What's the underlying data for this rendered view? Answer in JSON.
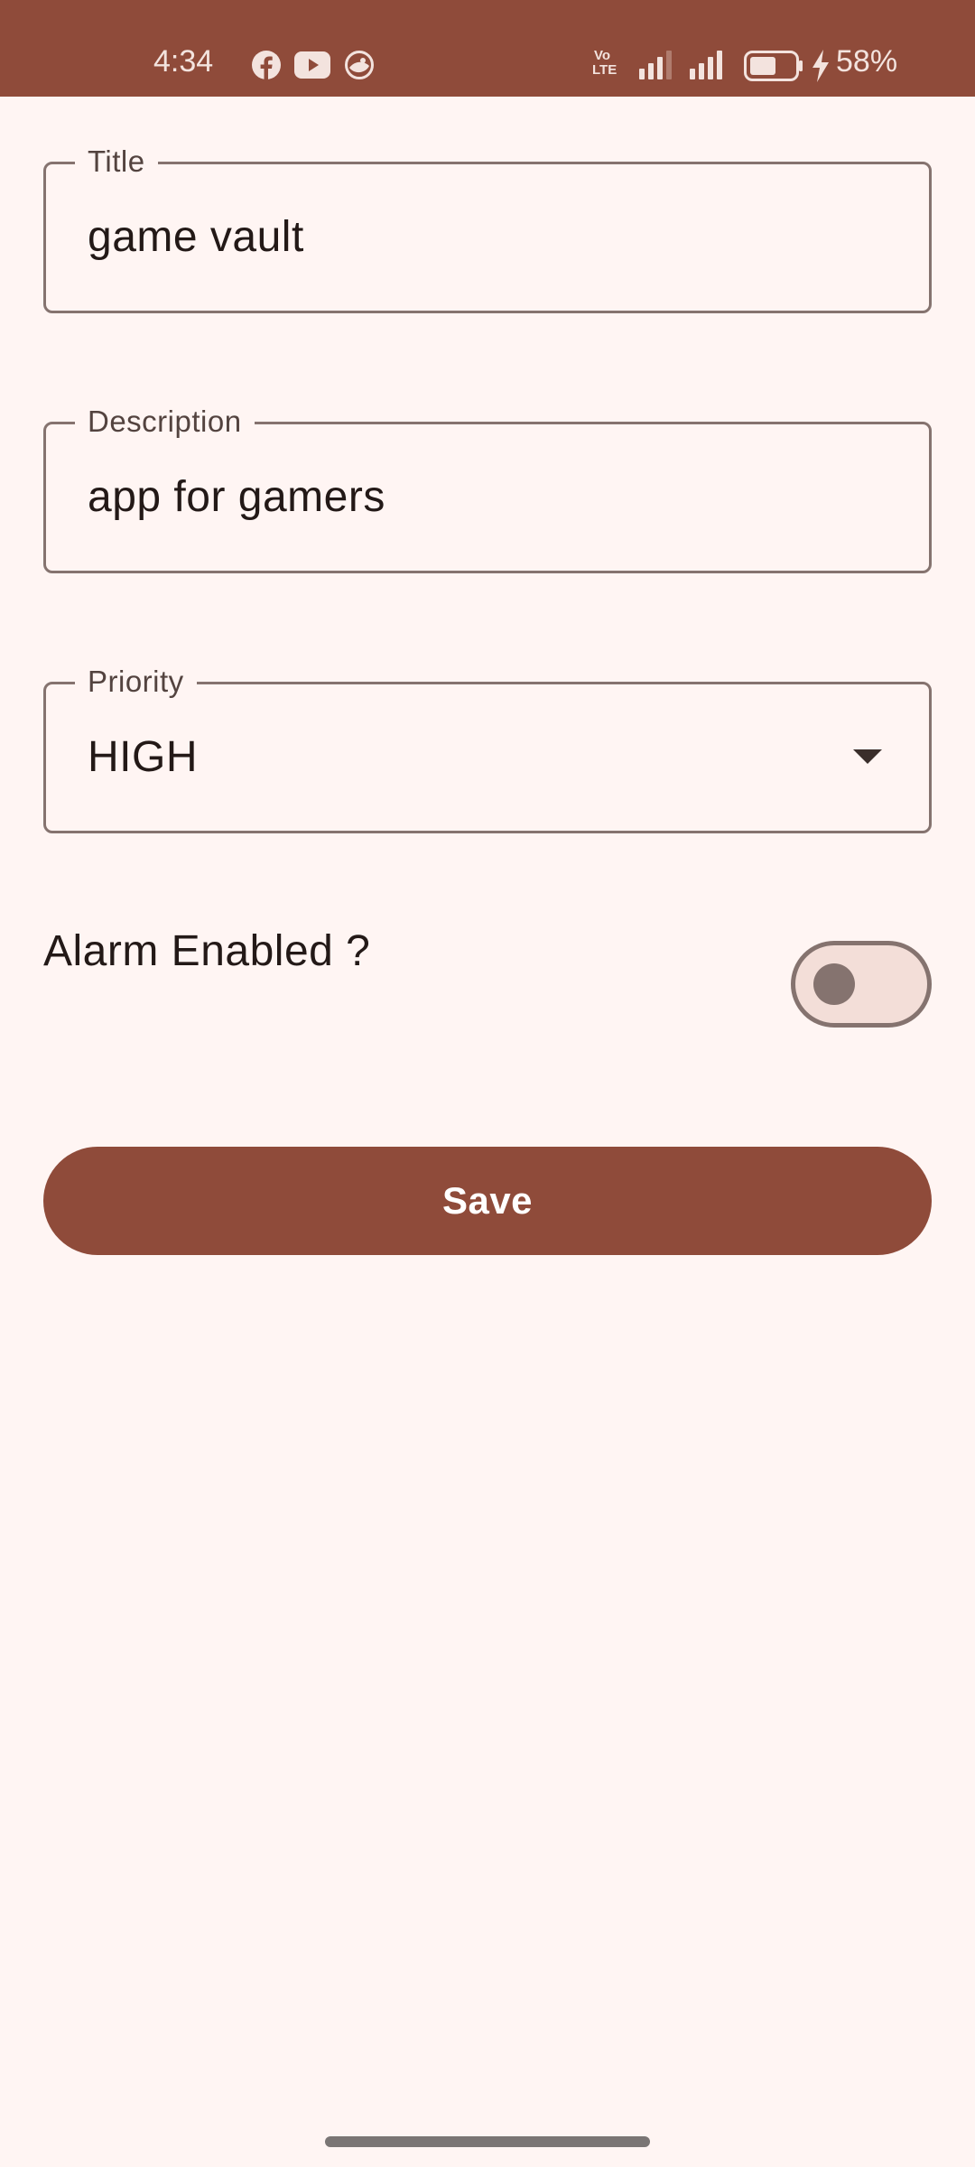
{
  "status_bar": {
    "time": "4:34",
    "battery_percent": "58%",
    "battery_level": 0.58,
    "notification_icons": [
      "facebook-icon",
      "youtube-icon",
      "app-notification-icon"
    ],
    "system_icons": [
      "volte-icon",
      "signal-icon",
      "signal-icon",
      "battery-icon",
      "charging-icon"
    ],
    "volte_text_top": "Vo",
    "volte_text_bottom": "LTE"
  },
  "form": {
    "title": {
      "label": "Title",
      "value": "game vault"
    },
    "description": {
      "label": "Description",
      "value": "app for gamers"
    },
    "priority": {
      "label": "Priority",
      "value": "HIGH"
    },
    "alarm": {
      "label": "Alarm Enabled ?",
      "enabled": false
    },
    "save_label": "Save"
  },
  "colors": {
    "primary": "#8F4B3A",
    "background": "#FFF5F3",
    "outline": "#85736F",
    "on_surface": "#231917"
  }
}
